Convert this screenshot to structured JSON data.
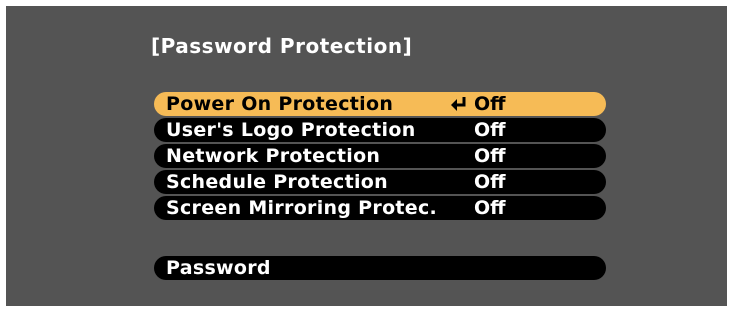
{
  "menu": {
    "title": "[Password Protection]",
    "items": [
      {
        "label": "Power On Protection",
        "value": "Off",
        "selected": true
      },
      {
        "label": "User's Logo Protection",
        "value": "Off",
        "selected": false
      },
      {
        "label": "Network Protection",
        "value": "Off",
        "selected": false
      },
      {
        "label": "Schedule Protection",
        "value": "Off",
        "selected": false
      },
      {
        "label": "Screen Mirroring Protec.",
        "value": "Off",
        "selected": false
      }
    ],
    "password": {
      "label": "Password"
    }
  },
  "colors": {
    "background": "#545454",
    "row": "#000000",
    "highlight": "#f6bb56",
    "text": "#ffffff"
  },
  "icons": {
    "enter": "enter-arrow-icon"
  }
}
